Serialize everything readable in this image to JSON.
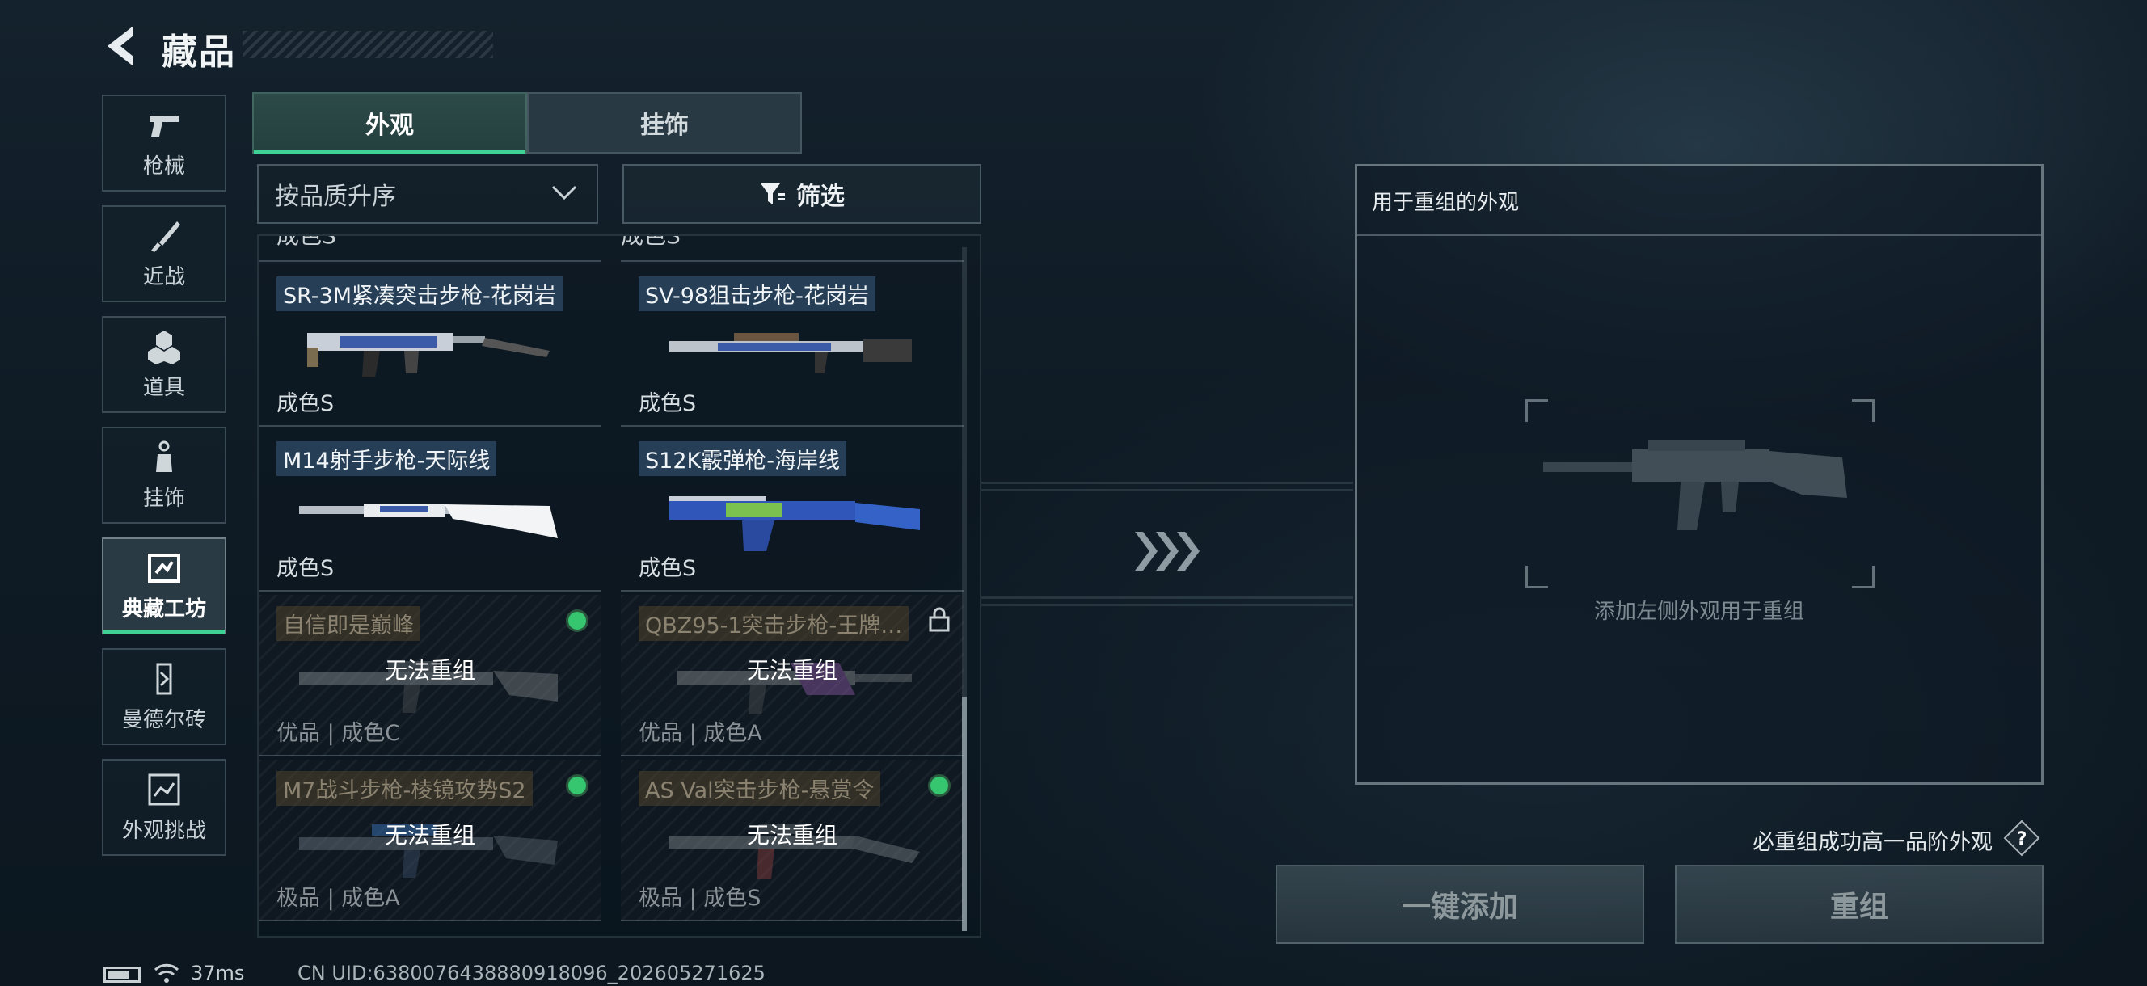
{
  "header": {
    "title": "藏品"
  },
  "categories": [
    {
      "label": "枪械",
      "icon": "pistol-icon"
    },
    {
      "label": "近战",
      "icon": "knife-icon"
    },
    {
      "label": "道具",
      "icon": "grenade-icon"
    },
    {
      "label": "挂饰",
      "icon": "charm-icon"
    },
    {
      "label": "典藏工坊",
      "icon": "workshop-icon",
      "active": true
    },
    {
      "label": "曼德尔砖",
      "icon": "brick-icon"
    },
    {
      "label": "外观挑战",
      "icon": "challenge-icon"
    }
  ],
  "tabs": [
    {
      "label": "外观",
      "active": true
    },
    {
      "label": "挂饰",
      "active": false
    }
  ],
  "sort": {
    "value": "按品质升序"
  },
  "filter": {
    "label": "筛选"
  },
  "list": {
    "partial_left": "成色S",
    "partial_right": "成色S",
    "items": [
      {
        "name": "SR-3M紧凑突击步枪-花岗岩",
        "condition": "成色S",
        "locked": false,
        "palette": "granite"
      },
      {
        "name": "SV-98狙击步枪-花岗岩",
        "condition": "成色S",
        "locked": false,
        "palette": "granite"
      },
      {
        "name": "M14射手步枪-天际线",
        "condition": "成色S",
        "locked": false,
        "palette": "white"
      },
      {
        "name": "S12K霰弹枪-海岸线",
        "condition": "成色S",
        "locked": false,
        "palette": "blue"
      },
      {
        "name": "自信即是巅峰",
        "condition": "优品 | 成色C",
        "locked": true,
        "status": "equipped",
        "overlay": "无法重组"
      },
      {
        "name": "QBZ95-1突击步枪-王牌…",
        "condition": "优品 | 成色A",
        "locked": true,
        "status": "locked",
        "overlay": "无法重组"
      },
      {
        "name": "M7战斗步枪-棱镜攻势S2",
        "condition": "极品 | 成色A",
        "locked": true,
        "status": "equipped",
        "overlay": "无法重组"
      },
      {
        "name": "AS Val突击步枪-悬赏令",
        "condition": "极品 | 成色S",
        "locked": true,
        "status": "equipped",
        "overlay": "无法重组"
      }
    ]
  },
  "panel": {
    "title": "用于重组的外观",
    "hint": "添加左侧外观用于重组"
  },
  "footer": {
    "must_text": "必重组成功高一品阶外观",
    "help": "?",
    "add_button": "一键添加",
    "recompose_button": "重组"
  },
  "status": {
    "ping": "37ms",
    "uid": "CN UID:6380076438880918096_202605271625"
  },
  "colors": {
    "accent": "#3fd095",
    "equipped": "#35c66f"
  }
}
